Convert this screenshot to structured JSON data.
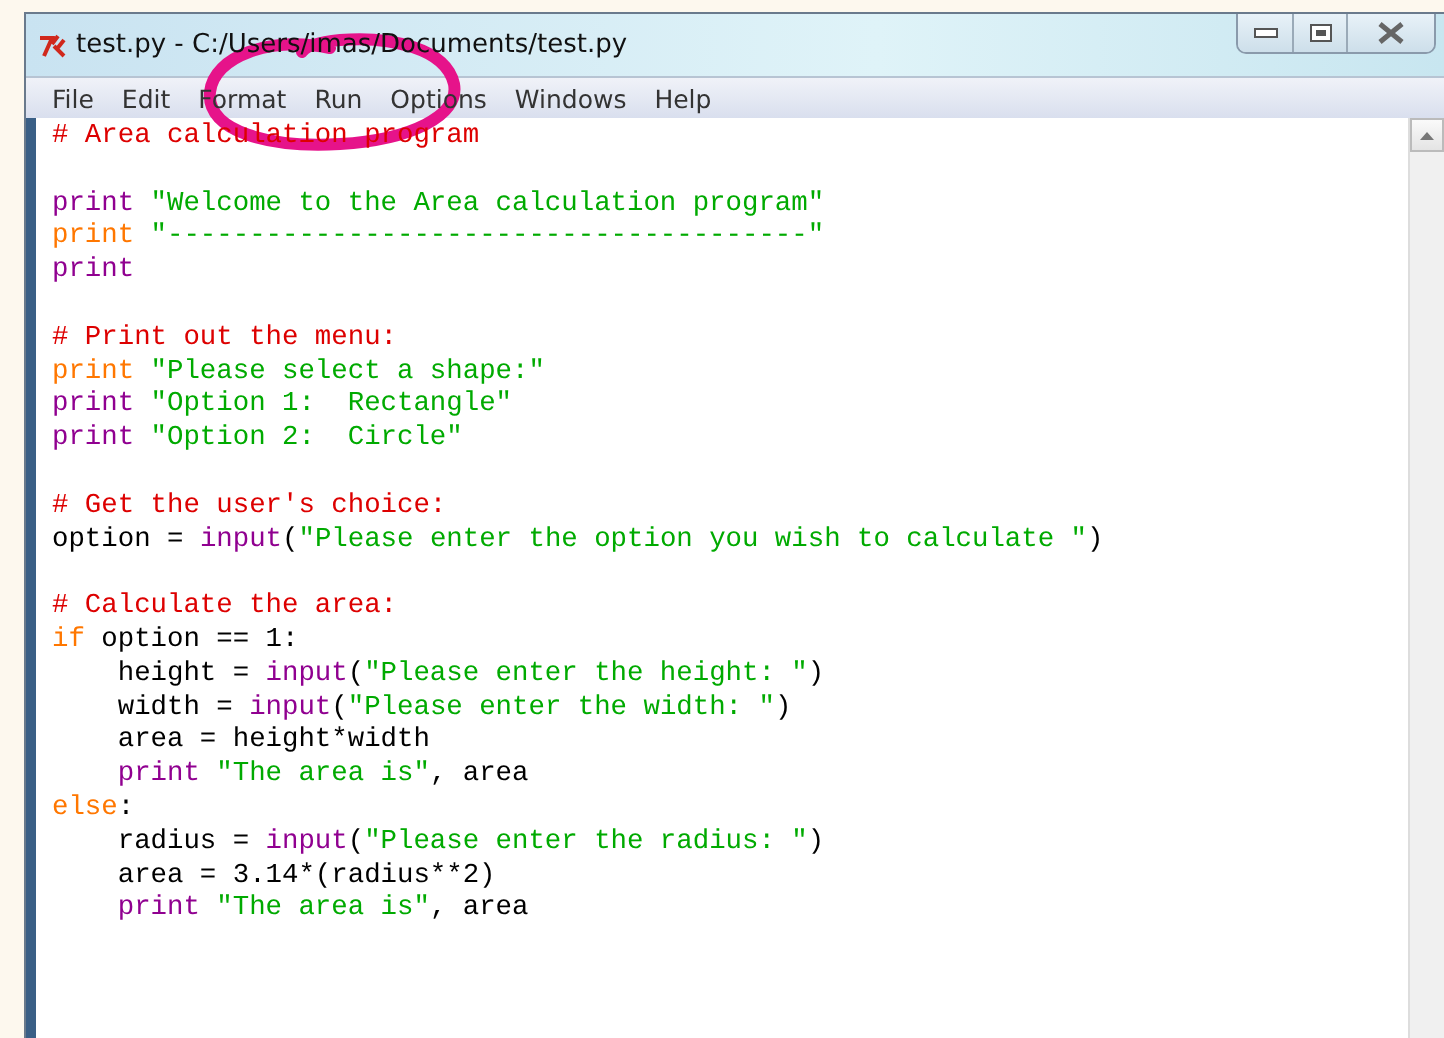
{
  "window": {
    "title": "test.py - C:/Users/imas/Documents/test.py"
  },
  "menu": [
    "File",
    "Edit",
    "Format",
    "Run",
    "Options",
    "Windows",
    "Help"
  ],
  "editor": {
    "lines": [
      {
        "tokens": [
          {
            "kind": "comment",
            "text": "# Area calculation program"
          }
        ]
      },
      {
        "kind": "blank"
      },
      {
        "tokens": [
          {
            "kind": "builtin",
            "text": "print"
          },
          {
            "kind": "string",
            "text": " \"Welcome to the Area calculation program\""
          }
        ]
      },
      {
        "tokens": [
          {
            "kind": "keyword",
            "text": "print"
          },
          {
            "kind": "string",
            "text": " \"---------------------------------------\""
          }
        ]
      },
      {
        "tokens": [
          {
            "kind": "builtin",
            "text": "print"
          }
        ]
      },
      {
        "kind": "blank"
      },
      {
        "tokens": [
          {
            "kind": "comment",
            "text": "# Print out the menu:"
          }
        ]
      },
      {
        "tokens": [
          {
            "kind": "keyword",
            "text": "print"
          },
          {
            "kind": "string",
            "text": " \"Please select a shape:\""
          }
        ]
      },
      {
        "tokens": [
          {
            "kind": "builtin",
            "text": "print"
          },
          {
            "kind": "string",
            "text": " \"Option 1:  Rectangle\""
          }
        ]
      },
      {
        "tokens": [
          {
            "kind": "builtin",
            "text": "print"
          },
          {
            "kind": "string",
            "text": " \"Option 2:  Circle\""
          }
        ]
      },
      {
        "kind": "blank"
      },
      {
        "tokens": [
          {
            "kind": "comment",
            "text": "# Get the user's choice:"
          }
        ]
      },
      {
        "tokens": [
          {
            "kind": "plain",
            "text": "option = "
          },
          {
            "kind": "builtin",
            "text": "input"
          },
          {
            "kind": "plain",
            "text": "("
          },
          {
            "kind": "string",
            "text": "\"Please enter the option you wish to calculate \""
          },
          {
            "kind": "plain",
            "text": ")"
          }
        ]
      },
      {
        "kind": "blank"
      },
      {
        "tokens": [
          {
            "kind": "comment",
            "text": "# Calculate the area:"
          }
        ]
      },
      {
        "tokens": [
          {
            "kind": "keyword",
            "text": "if"
          },
          {
            "kind": "plain",
            "text": " option == 1:"
          }
        ]
      },
      {
        "tokens": [
          {
            "kind": "plain",
            "text": "    height = "
          },
          {
            "kind": "builtin",
            "text": "input"
          },
          {
            "kind": "plain",
            "text": "("
          },
          {
            "kind": "string",
            "text": "\"Please enter the height: \""
          },
          {
            "kind": "plain",
            "text": ")"
          }
        ]
      },
      {
        "tokens": [
          {
            "kind": "plain",
            "text": "    width = "
          },
          {
            "kind": "builtin",
            "text": "input"
          },
          {
            "kind": "plain",
            "text": "("
          },
          {
            "kind": "string",
            "text": "\"Please enter the width: \""
          },
          {
            "kind": "plain",
            "text": ")"
          }
        ]
      },
      {
        "tokens": [
          {
            "kind": "plain",
            "text": "    area = height*width"
          }
        ]
      },
      {
        "tokens": [
          {
            "kind": "builtin",
            "text": "    print"
          },
          {
            "kind": "string",
            "text": " \"The area is\""
          },
          {
            "kind": "plain",
            "text": ", area"
          }
        ]
      },
      {
        "tokens": [
          {
            "kind": "keyword",
            "text": "else"
          },
          {
            "kind": "plain",
            "text": ":"
          }
        ]
      },
      {
        "tokens": [
          {
            "kind": "plain",
            "text": "    radius = "
          },
          {
            "kind": "builtin",
            "text": "input"
          },
          {
            "kind": "plain",
            "text": "("
          },
          {
            "kind": "string",
            "text": "\"Please enter the radius: \""
          },
          {
            "kind": "plain",
            "text": ")"
          }
        ]
      },
      {
        "tokens": [
          {
            "kind": "plain",
            "text": "    area = 3.14*(radius**2)"
          }
        ]
      },
      {
        "tokens": [
          {
            "kind": "builtin",
            "text": "    print"
          },
          {
            "kind": "string",
            "text": " \"The area is\""
          },
          {
            "kind": "plain",
            "text": ", area"
          }
        ]
      }
    ]
  }
}
